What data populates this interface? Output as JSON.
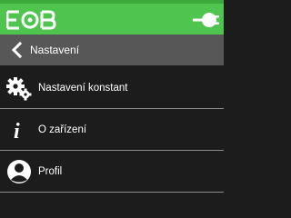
{
  "app": {
    "logo_text": "EOB",
    "topbar_color": "#4fc54f",
    "status_icon": "plug-icon"
  },
  "navbar": {
    "back_icon": "chevron-left-icon",
    "title": "Nastavení"
  },
  "menu": {
    "items": [
      {
        "icon": "gears-icon",
        "label": "Nastavení konstant"
      },
      {
        "icon": "info-icon",
        "label": "O zařízení"
      },
      {
        "icon": "profile-icon",
        "label": "Profil"
      }
    ]
  }
}
